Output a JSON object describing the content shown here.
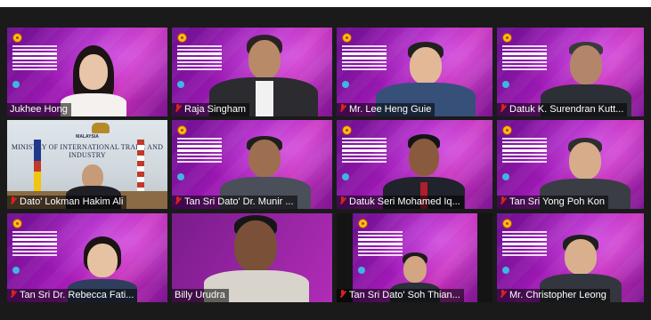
{
  "ministry": {
    "country": "MALAYSIA",
    "name": "MINISTRY OF INTERNATIONAL TRADE AND INDUSTRY"
  },
  "participants": [
    {
      "name": "Jukhee Hong",
      "muted": false
    },
    {
      "name": "Raja Singham",
      "muted": true
    },
    {
      "name": "Mr. Lee Heng Guie",
      "muted": true
    },
    {
      "name": "Datuk K. Surendran Kutt...",
      "muted": true
    },
    {
      "name": "Dato' Lokman Hakim Ali",
      "muted": true
    },
    {
      "name": "Tan Sri Dato' Dr. Munir ...",
      "muted": true
    },
    {
      "name": "Datuk Seri Mohamed Iq...",
      "muted": true
    },
    {
      "name": "Tan Sri Yong Poh Kon",
      "muted": true
    },
    {
      "name": "Tan Sri Dr. Rebecca Fati...",
      "muted": true
    },
    {
      "name": "Billy Urudra",
      "muted": false
    },
    {
      "name": "Tan Sri Dato' Soh Thian...",
      "muted": true
    },
    {
      "name": "Mr. Christopher Leong",
      "muted": true
    }
  ],
  "colors": {
    "background": "#1a1a1a",
    "tile_purple": "#a31ab8",
    "muted_mic": "#e02020"
  }
}
